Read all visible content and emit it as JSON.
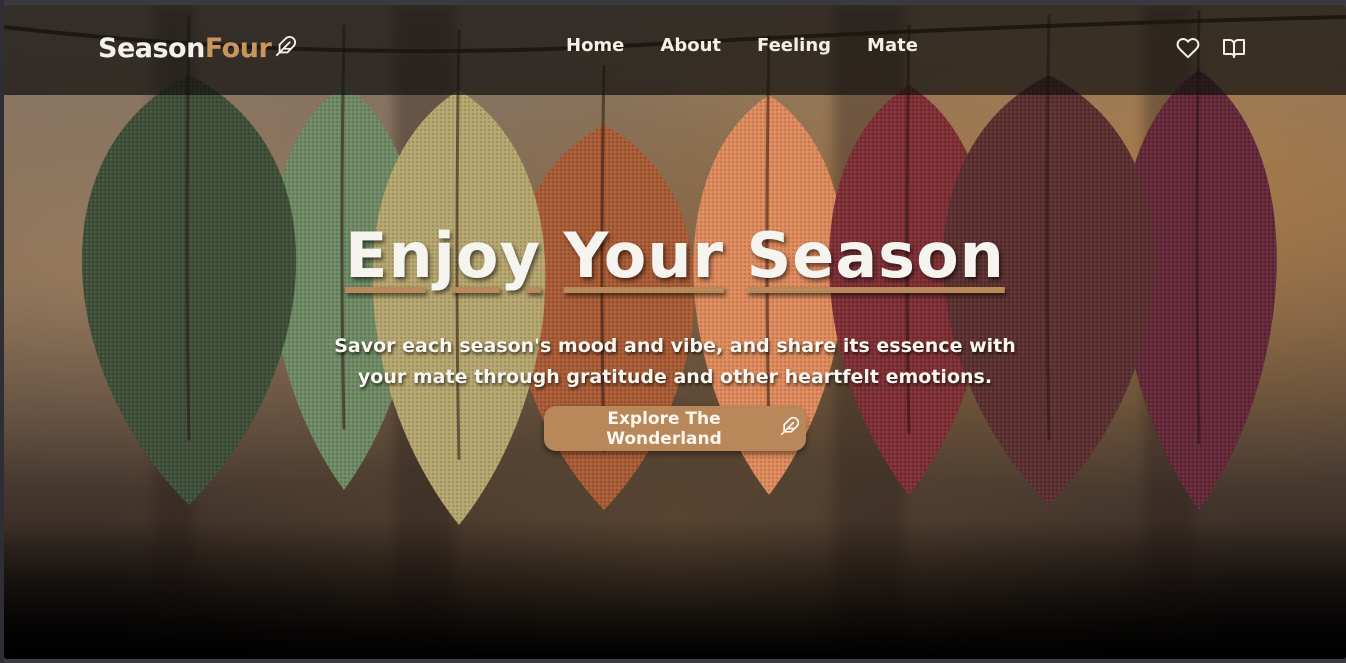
{
  "brand": {
    "part1": "Season",
    "part2": "Four",
    "icon": "feather-icon"
  },
  "nav": {
    "links": [
      "Home",
      "About",
      "Feeling",
      "Mate"
    ],
    "icons": [
      "heart-icon",
      "book-open-icon"
    ]
  },
  "hero": {
    "title_words": [
      "Enjoy",
      "Your",
      "Season"
    ],
    "subtitle": "Savor each season's mood and vibe, and share its essence with your mate through gratitude and other heartfelt emotions.",
    "cta_label": "Explore The Wonderland",
    "cta_icon": "feather-icon"
  },
  "colors": {
    "accent": "#b8875a",
    "logo_accent": "#c8955c",
    "nav_bg": "#14120f",
    "text_light": "#f5f4ef"
  },
  "leaf_colors": [
    "#3f4f38",
    "#6e8a64",
    "#b5a66e",
    "#a95b35",
    "#de8a5c",
    "#7e2f34",
    "#5b3030",
    "#642838"
  ]
}
